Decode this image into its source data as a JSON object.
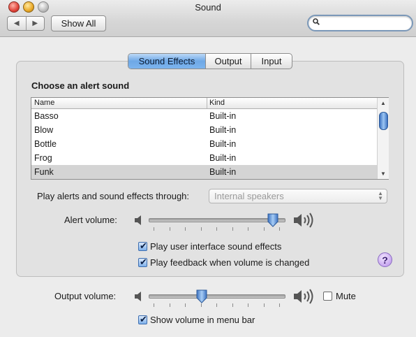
{
  "window": {
    "title": "Sound"
  },
  "toolbar": {
    "show_all": "Show All",
    "back_glyph": "◀",
    "forward_glyph": "▶",
    "search_value": ""
  },
  "tabs": [
    {
      "label": "Sound Effects",
      "active": true
    },
    {
      "label": "Output",
      "active": false
    },
    {
      "label": "Input",
      "active": false
    }
  ],
  "sound_effects": {
    "heading": "Choose an alert sound",
    "columns": [
      "Name",
      "Kind"
    ],
    "rows": [
      {
        "name": "Basso",
        "kind": "Built-in",
        "selected": false
      },
      {
        "name": "Blow",
        "kind": "Built-in",
        "selected": false
      },
      {
        "name": "Bottle",
        "kind": "Built-in",
        "selected": false
      },
      {
        "name": "Frog",
        "kind": "Built-in",
        "selected": false
      },
      {
        "name": "Funk",
        "kind": "Built-in",
        "selected": true
      }
    ],
    "play_through_label": "Play alerts and sound effects through:",
    "play_through_value": "Internal speakers",
    "alert_volume_label": "Alert volume:",
    "alert_volume_fraction": 0.96,
    "checkbox_ui_sounds": {
      "label": "Play user interface sound effects",
      "checked": true
    },
    "checkbox_feedback": {
      "label": "Play feedback when volume is changed",
      "checked": true
    },
    "help_glyph": "?"
  },
  "output_volume": {
    "label": "Output volume:",
    "fraction": 0.38,
    "mute_label": "Mute",
    "mute_checked": false,
    "menu_bar_label": "Show volume in menu bar",
    "menu_bar_checked": true
  },
  "colors": {
    "accent": "#6ea8e6",
    "selection_row": "#d4d4d4"
  }
}
